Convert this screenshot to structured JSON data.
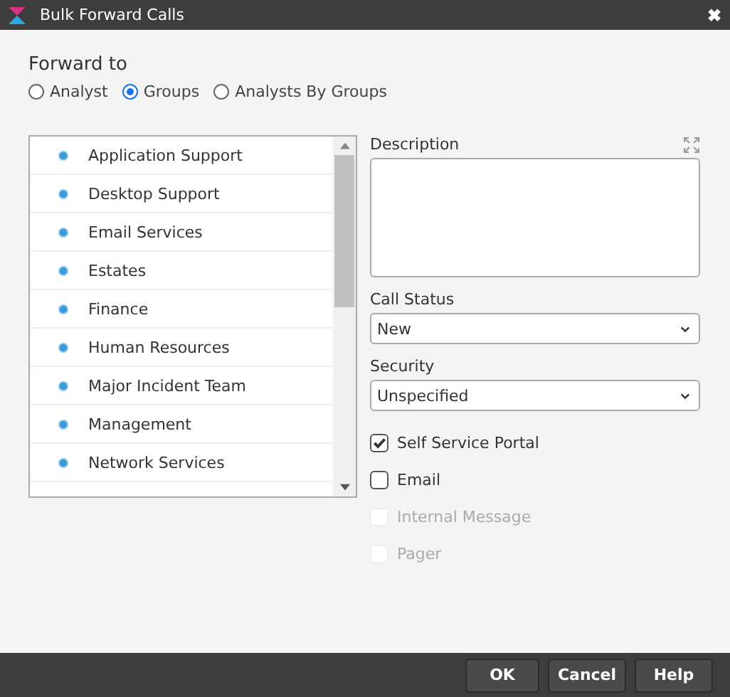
{
  "window": {
    "title": "Bulk Forward Calls",
    "close": "✖"
  },
  "forward_to": {
    "label": "Forward to",
    "options": [
      {
        "label": "Analyst",
        "selected": false
      },
      {
        "label": "Groups",
        "selected": true
      },
      {
        "label": "Analysts By Groups",
        "selected": false
      }
    ]
  },
  "groups": [
    {
      "label": "Application Support"
    },
    {
      "label": "Desktop Support"
    },
    {
      "label": "Email Services"
    },
    {
      "label": "Estates"
    },
    {
      "label": "Finance"
    },
    {
      "label": "Human Resources"
    },
    {
      "label": "Major Incident Team"
    },
    {
      "label": "Management"
    },
    {
      "label": "Network Services"
    }
  ],
  "description": {
    "label": "Description"
  },
  "call_status": {
    "label": "Call Status",
    "value": "New"
  },
  "security": {
    "label": "Security",
    "value": "Unspecified"
  },
  "notifications": [
    {
      "label": "Self Service Portal",
      "checked": true,
      "disabled": false
    },
    {
      "label": "Email",
      "checked": false,
      "disabled": false
    },
    {
      "label": "Internal Message",
      "checked": false,
      "disabled": true
    },
    {
      "label": "Pager",
      "checked": false,
      "disabled": true
    }
  ],
  "buttons": [
    "OK",
    "Cancel",
    "Help"
  ]
}
